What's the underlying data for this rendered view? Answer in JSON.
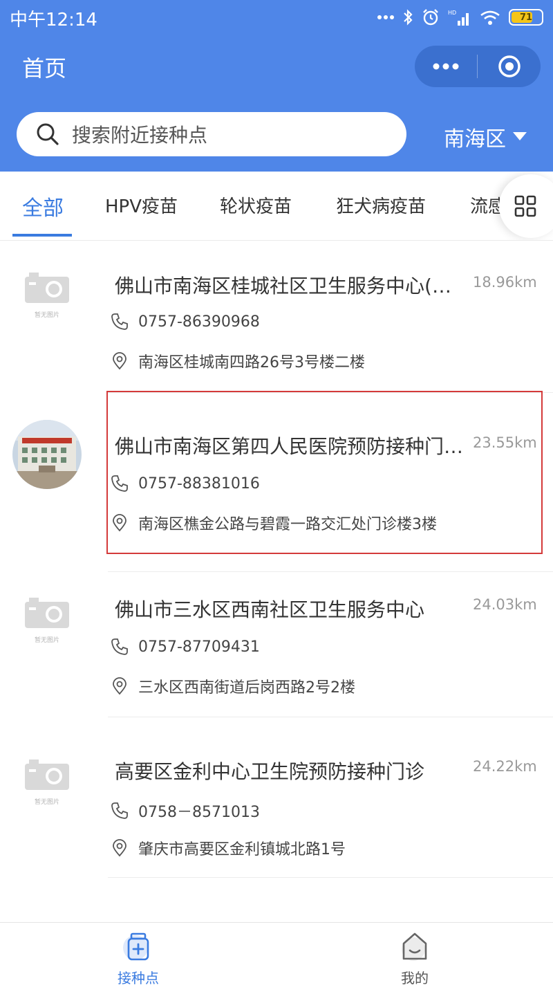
{
  "status_bar": {
    "time": "中午12:14",
    "battery": "71",
    "battery_level": 0.71
  },
  "header": {
    "title": "首页",
    "search_placeholder": "搜索附近接种点",
    "district": "南海区"
  },
  "tabs": [
    {
      "label": "全部",
      "active": true
    },
    {
      "label": "HPV疫苗"
    },
    {
      "label": "轮状疫苗"
    },
    {
      "label": "狂犬病疫苗"
    },
    {
      "label": "流感"
    }
  ],
  "placeholder_image_text": "暂无图片",
  "list": [
    {
      "name": "佛山市南海区桂城社区卫生服务中心(桂城社区卫生服务中心)",
      "distance": "18.96km",
      "phone": "0757-86390968",
      "address": "南海区桂城南四路26号3号楼二楼",
      "has_photo": false
    },
    {
      "name": "佛山市南海区第四人民医院预防接种门诊部",
      "distance": "23.55km",
      "phone": "0757-88381016",
      "address": "南海区樵金公路与碧霞一路交汇处门诊楼3楼",
      "has_photo": true,
      "highlighted": true
    },
    {
      "name": "佛山市三水区西南社区卫生服务中心",
      "distance": "24.03km",
      "phone": "0757-87709431",
      "address": "三水区西南街道后岗西路2号2楼",
      "has_photo": false
    },
    {
      "name": "高要区金利中心卫生院预防接种门诊",
      "distance": "24.22km",
      "phone": "0758－8571013",
      "address": "肇庆市高要区金利镇城北路1号",
      "has_photo": false
    }
  ],
  "tabbar": [
    {
      "label": "接种点",
      "active": true
    },
    {
      "label": "我的"
    }
  ],
  "colors": {
    "brand": "#4f86e8",
    "active_tab": "#3a7be0",
    "highlight_border": "#d43a3a",
    "text": "#333333",
    "muted": "#999999"
  }
}
